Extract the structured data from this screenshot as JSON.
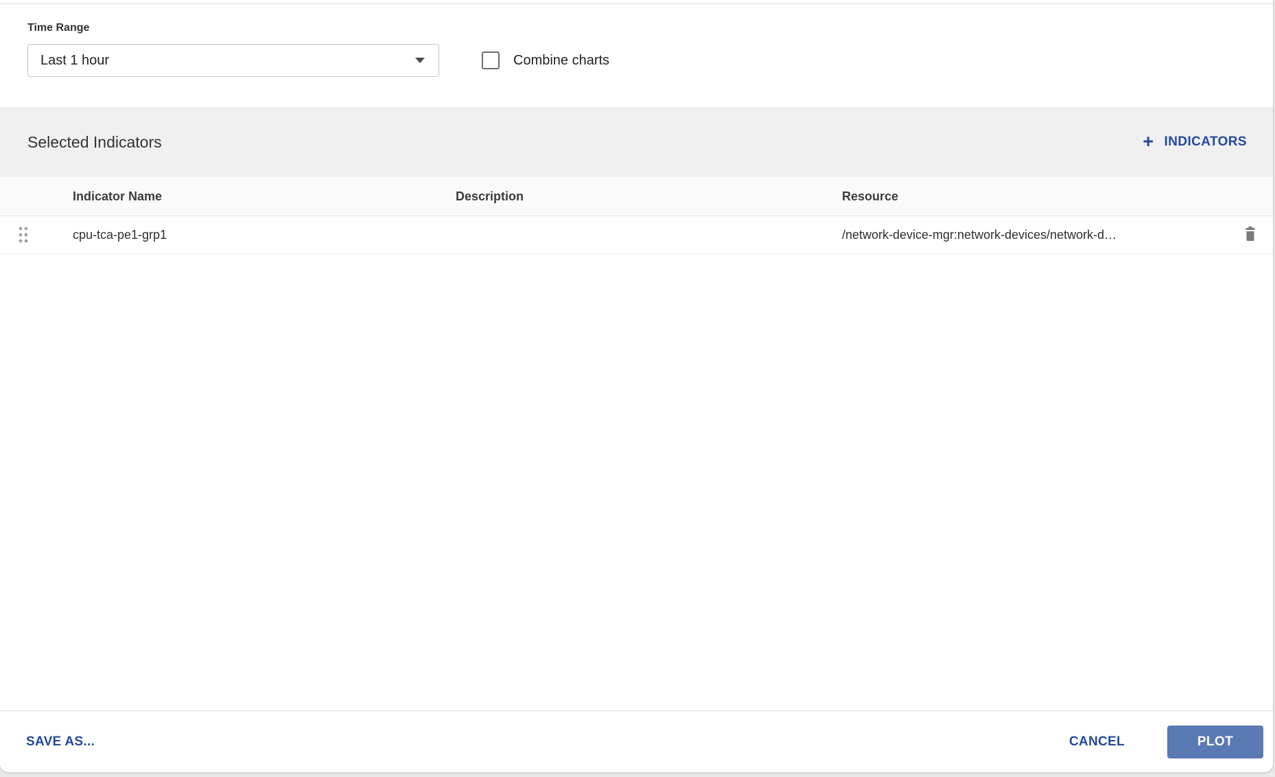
{
  "time_range": {
    "label": "Time Range",
    "value": "Last 1 hour"
  },
  "combine_charts": {
    "label": "Combine charts",
    "checked": false
  },
  "indicators_section": {
    "title": "Selected Indicators",
    "add_button_icon": "+",
    "add_button_label": "INDICATORS"
  },
  "table": {
    "headers": {
      "name": "Indicator Name",
      "description": "Description",
      "resource": "Resource"
    },
    "rows": [
      {
        "name": "cpu-tca-pe1-grp1",
        "description": "",
        "resource": "/network-device-mgr:network-devices/network-d…"
      }
    ]
  },
  "footer": {
    "save_as_label": "SAVE AS...",
    "cancel_label": "CANCEL",
    "plot_label": "PLOT"
  },
  "icons": {
    "dropdown": "caret-down-icon",
    "row_drag": "drag-handle-icon",
    "row_delete": "trash-icon",
    "add": "plus-icon"
  },
  "colors": {
    "accent_blue": "#24499c",
    "plot_button_blue": "#5b79b2",
    "section_background": "#f0f0f0",
    "page_background": "#e9e9e9"
  }
}
